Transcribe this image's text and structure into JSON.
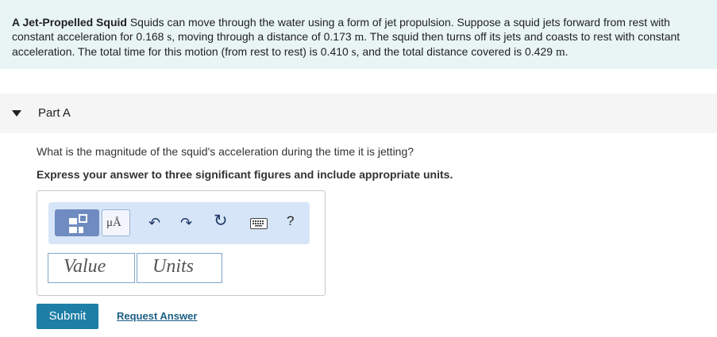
{
  "problem": {
    "title": "A Jet-Propelled Squid",
    "seg1": " Squids can move through the water using a form of jet propulsion. Suppose a squid jets forward from rest with constant acceleration for 0.168 ",
    "u1": "s",
    "seg2": ", moving through a distance of 0.173 ",
    "u2": "m",
    "seg3": ". The squid then turns off its jets and coasts to rest with constant acceleration. The total time for this motion (from rest to rest) is 0.410 ",
    "u3": "s",
    "seg4": ", and the total distance covered is 0.429 ",
    "u4": "m",
    "seg5": "."
  },
  "part": {
    "label": "Part A"
  },
  "question": "What is the magnitude of the squid's acceleration during the time it is jetting?",
  "instruction": "Express your answer to three significant figures and include appropriate units.",
  "toolbar": {
    "units_symbol": "μÅ",
    "undo_glyph": "↶",
    "redo_glyph": "↷",
    "reset_glyph": "↻",
    "help_glyph": "?"
  },
  "inputs": {
    "value_placeholder": "Value",
    "units_placeholder": "Units"
  },
  "actions": {
    "submit_label": "Submit",
    "request_label": "Request Answer"
  }
}
